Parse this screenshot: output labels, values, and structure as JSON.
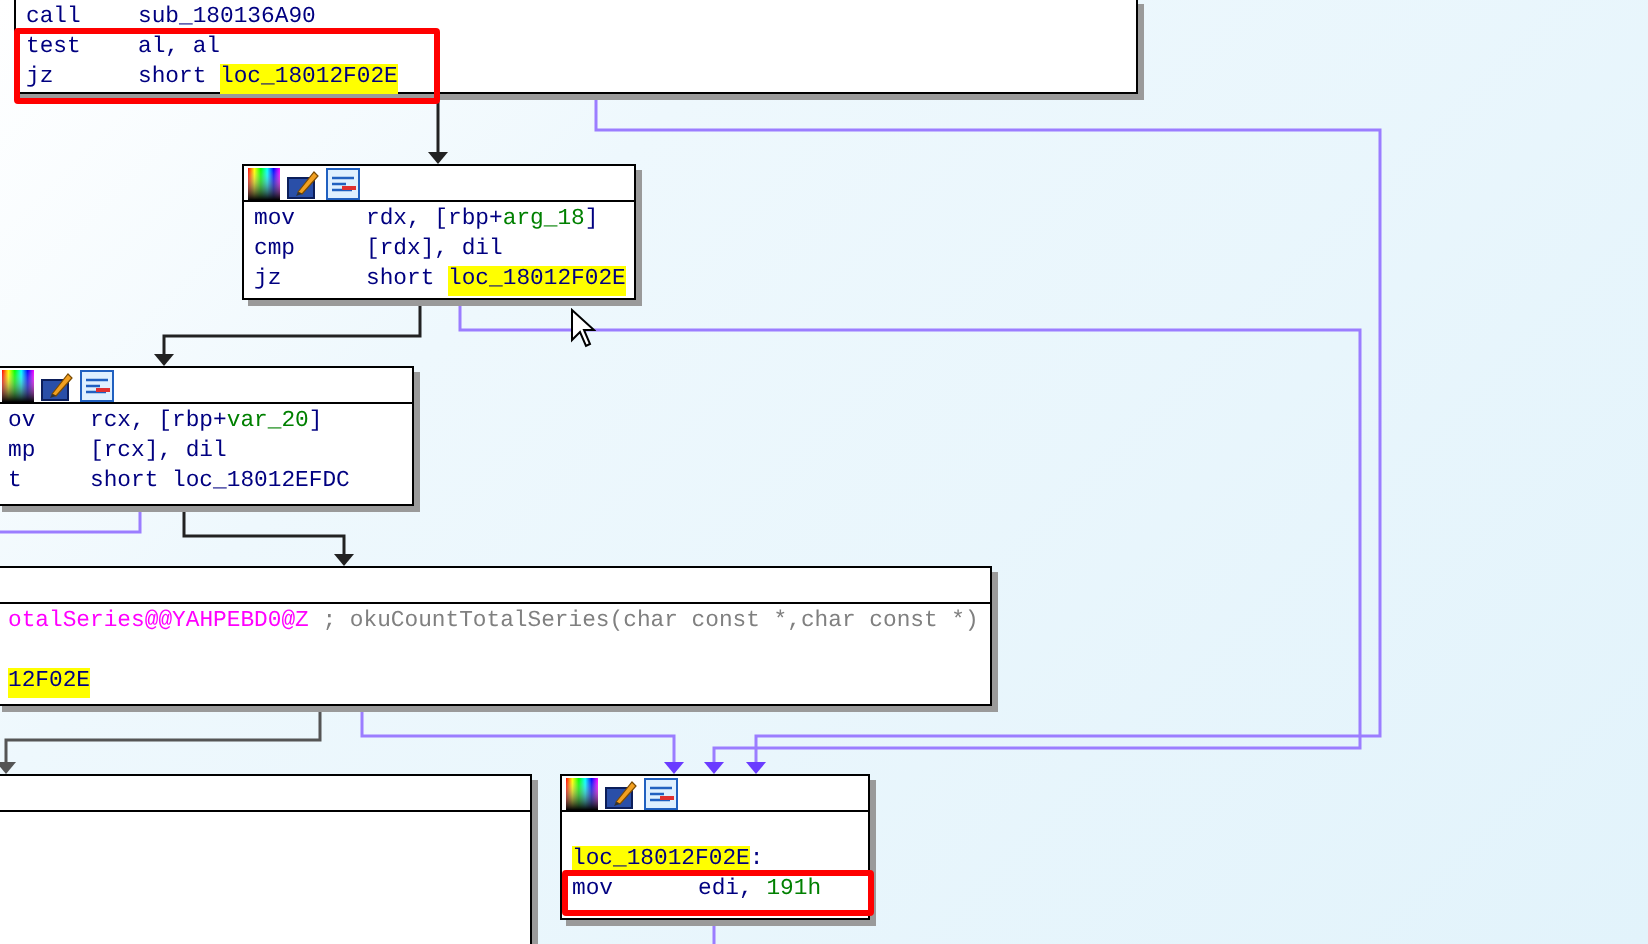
{
  "nodes": [
    {
      "kind": "plain",
      "lines": [
        {
          "kind": "code",
          "mnemonic": "call",
          "parts": [
            {
              "kind": "plain",
              "text": "sub_180136A90"
            }
          ]
        },
        {
          "kind": "code",
          "marked": true,
          "mnemonic": "test",
          "parts": [
            {
              "kind": "plain",
              "text": "al, al"
            }
          ]
        },
        {
          "kind": "code",
          "marked": true,
          "mnemonic": "jz",
          "parts": [
            {
              "kind": "plain",
              "text": "short "
            },
            {
              "kind": "label",
              "text": "loc_18012F02E",
              "highlighted": true
            }
          ]
        }
      ]
    },
    {
      "kind": "icons",
      "lines": [
        {
          "kind": "code",
          "mnemonic": "mov",
          "parts": [
            {
              "kind": "plain",
              "text": "rdx, [rbp+"
            },
            {
              "kind": "var",
              "text": "arg_18"
            },
            {
              "kind": "plain",
              "text": "]"
            }
          ]
        },
        {
          "kind": "code",
          "mnemonic": "cmp",
          "parts": [
            {
              "kind": "plain",
              "text": "[rdx], dil"
            }
          ]
        },
        {
          "kind": "code",
          "mnemonic": "jz",
          "parts": [
            {
              "kind": "plain",
              "text": "short "
            },
            {
              "kind": "label",
              "text": "loc_18012F02E",
              "highlighted": true
            }
          ]
        }
      ]
    },
    {
      "kind": "icons",
      "lines": [
        {
          "kind": "code",
          "mnemonic": "ov",
          "parts": [
            {
              "kind": "plain",
              "text": "rcx, [rbp+"
            },
            {
              "kind": "var",
              "text": "var_20"
            },
            {
              "kind": "plain",
              "text": "]"
            }
          ]
        },
        {
          "kind": "code",
          "mnemonic": "mp",
          "parts": [
            {
              "kind": "plain",
              "text": "[rcx], dil"
            }
          ]
        },
        {
          "kind": "code",
          "mnemonic": "t",
          "parts": [
            {
              "kind": "plain",
              "text": "short "
            },
            {
              "kind": "label",
              "text": "loc_18012EFDC",
              "highlighted": false
            }
          ]
        }
      ]
    },
    {
      "kind": "plain",
      "lines": [
        {
          "kind": "code",
          "parts": [
            {
              "kind": "symbol",
              "text": "otalSeries@@YAHPEBD0@Z"
            },
            {
              "kind": "comment",
              "text": " ; okuCountTotalSeries(char const *,char const *)"
            }
          ]
        },
        {
          "kind": "blank"
        },
        {
          "kind": "code",
          "parts": [
            {
              "kind": "label",
              "text": "12F02E",
              "highlighted": true
            }
          ]
        }
      ]
    },
    {
      "kind": "plain"
    },
    {
      "kind": "icons",
      "lines": [
        {
          "kind": "blank"
        },
        {
          "kind": "code",
          "parts": [
            {
              "kind": "label",
              "text": "loc_18012F02E",
              "highlighted": true
            },
            {
              "kind": "plain",
              "text": ":"
            }
          ]
        },
        {
          "kind": "code",
          "marked": true,
          "mnemonic": "mov",
          "parts": [
            {
              "kind": "plain",
              "text": "edi, "
            },
            {
              "kind": "number",
              "text": "191h"
            }
          ]
        }
      ]
    }
  ]
}
